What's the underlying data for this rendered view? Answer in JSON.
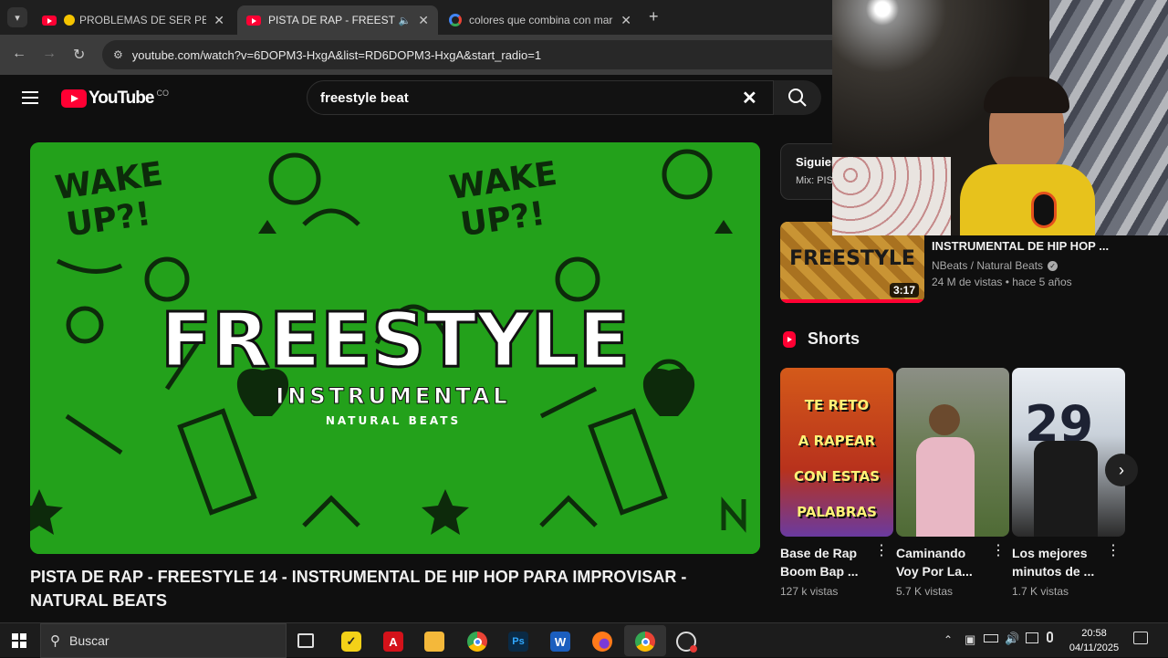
{
  "browser": {
    "tabs": [
      {
        "title": "PROBLEMAS DE SER PEQUE"
      },
      {
        "title": "PISTA DE RAP - FREESTYLE"
      },
      {
        "title": "colores que combina con marr"
      }
    ],
    "url": "youtube.com/watch?v=6DOPM3-HxgA&list=RD6DOPM3-HxgA&start_radio=1"
  },
  "youtube": {
    "logo_text": "YouTube",
    "country_code": "CO",
    "search_value": "freestyle beat"
  },
  "player": {
    "thumb_title": "FREESTYLE",
    "thumb_subtitle": "INSTRUMENTAL",
    "thumb_brand": "NATURAL BEATS",
    "thumb_words": [
      "WAKE",
      "UP?!",
      "WAKE",
      "UP?!"
    ]
  },
  "video": {
    "title": "PISTA DE RAP - FREESTYLE 14 - INSTRUMENTAL DE HIP HOP PARA IMPROVISAR - NATURAL BEATS"
  },
  "queue": {
    "heading": "Siguier",
    "sub": "Mix: PIS"
  },
  "recommended": {
    "title": "INSTRUMENTAL DE HIP HOP ...",
    "channel": "NBeats / Natural Beats",
    "meta": "24 M de vistas • hace 5 años",
    "duration": "3:17",
    "thumb_text": "FREESTYLE"
  },
  "shorts": {
    "heading": "Shorts",
    "items": [
      {
        "title": "Base de Rap Boom Bap ...",
        "views": "127 k vistas",
        "thumb_lines": [
          "TE RETO",
          "A RAPEAR",
          "CON ESTAS",
          "PALABRAS"
        ]
      },
      {
        "title": "Caminando Voy Por La...",
        "views": "5.7 K vistas"
      },
      {
        "title": "Los mejores minutos de ...",
        "views": "1.7 K vistas",
        "thumb_text": "29"
      }
    ]
  },
  "taskbar": {
    "search_placeholder": "Buscar",
    "time": "20:58",
    "date": "04/11/2025"
  }
}
